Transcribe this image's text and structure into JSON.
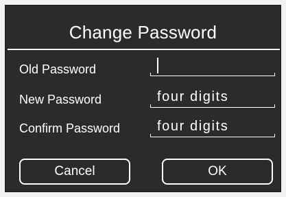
{
  "dialog": {
    "title": "Change Password",
    "fields": [
      {
        "label": "Old Password",
        "value": ""
      },
      {
        "label": "New Password",
        "value": "four digits"
      },
      {
        "label": "Confirm Password",
        "value": "four digits"
      }
    ],
    "buttons": {
      "cancel": "Cancel",
      "ok": "OK"
    }
  }
}
